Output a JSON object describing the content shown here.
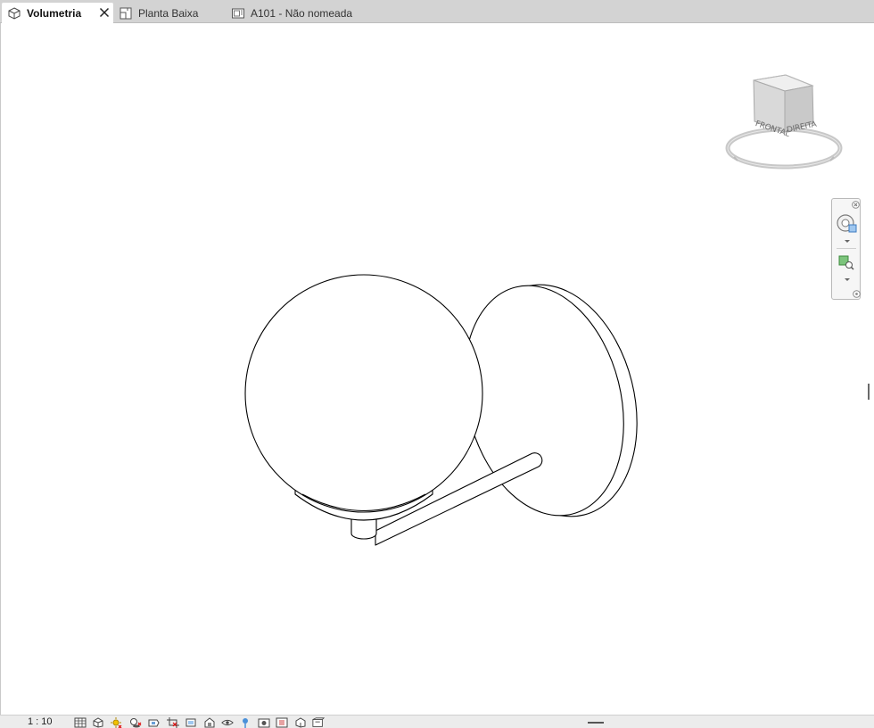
{
  "tabs": [
    {
      "label": "Volumetria",
      "icon": "3d-view-icon",
      "active": true,
      "closable": true
    },
    {
      "label": "Planta Baixa",
      "icon": "floor-plan-icon",
      "active": false,
      "closable": false
    },
    {
      "label": "A101 - Não nomeada",
      "icon": "sheet-icon",
      "active": false,
      "closable": false
    }
  ],
  "viewcube": {
    "face_front": "FRONTAL",
    "face_right": "DIREITA"
  },
  "navbar": {
    "items": [
      "close-icon",
      "steering-wheel-icon",
      "dropdown-arrow-icon",
      "zoom-region-icon",
      "dropdown-arrow-icon",
      "options-icon"
    ]
  },
  "statusbar": {
    "scale": "1 : 10",
    "icons": [
      "detail-level-icon",
      "visual-style-icon",
      "sun-path-icon",
      "shadows-icon",
      "render-icon",
      "crop-view-icon",
      "show-crop-icon",
      "unlock-3d-view-icon",
      "temporary-hide-icon",
      "reveal-hidden-icon",
      "worksharing-icon",
      "design-options-icon",
      "analytical-model-icon",
      "highlight-boundaries-icon",
      "constraints-icon"
    ]
  },
  "colors": {
    "tabbar": "#d3d3d3",
    "canvas": "#ffffff",
    "line": "#000000",
    "statusbar": "#ececec"
  }
}
